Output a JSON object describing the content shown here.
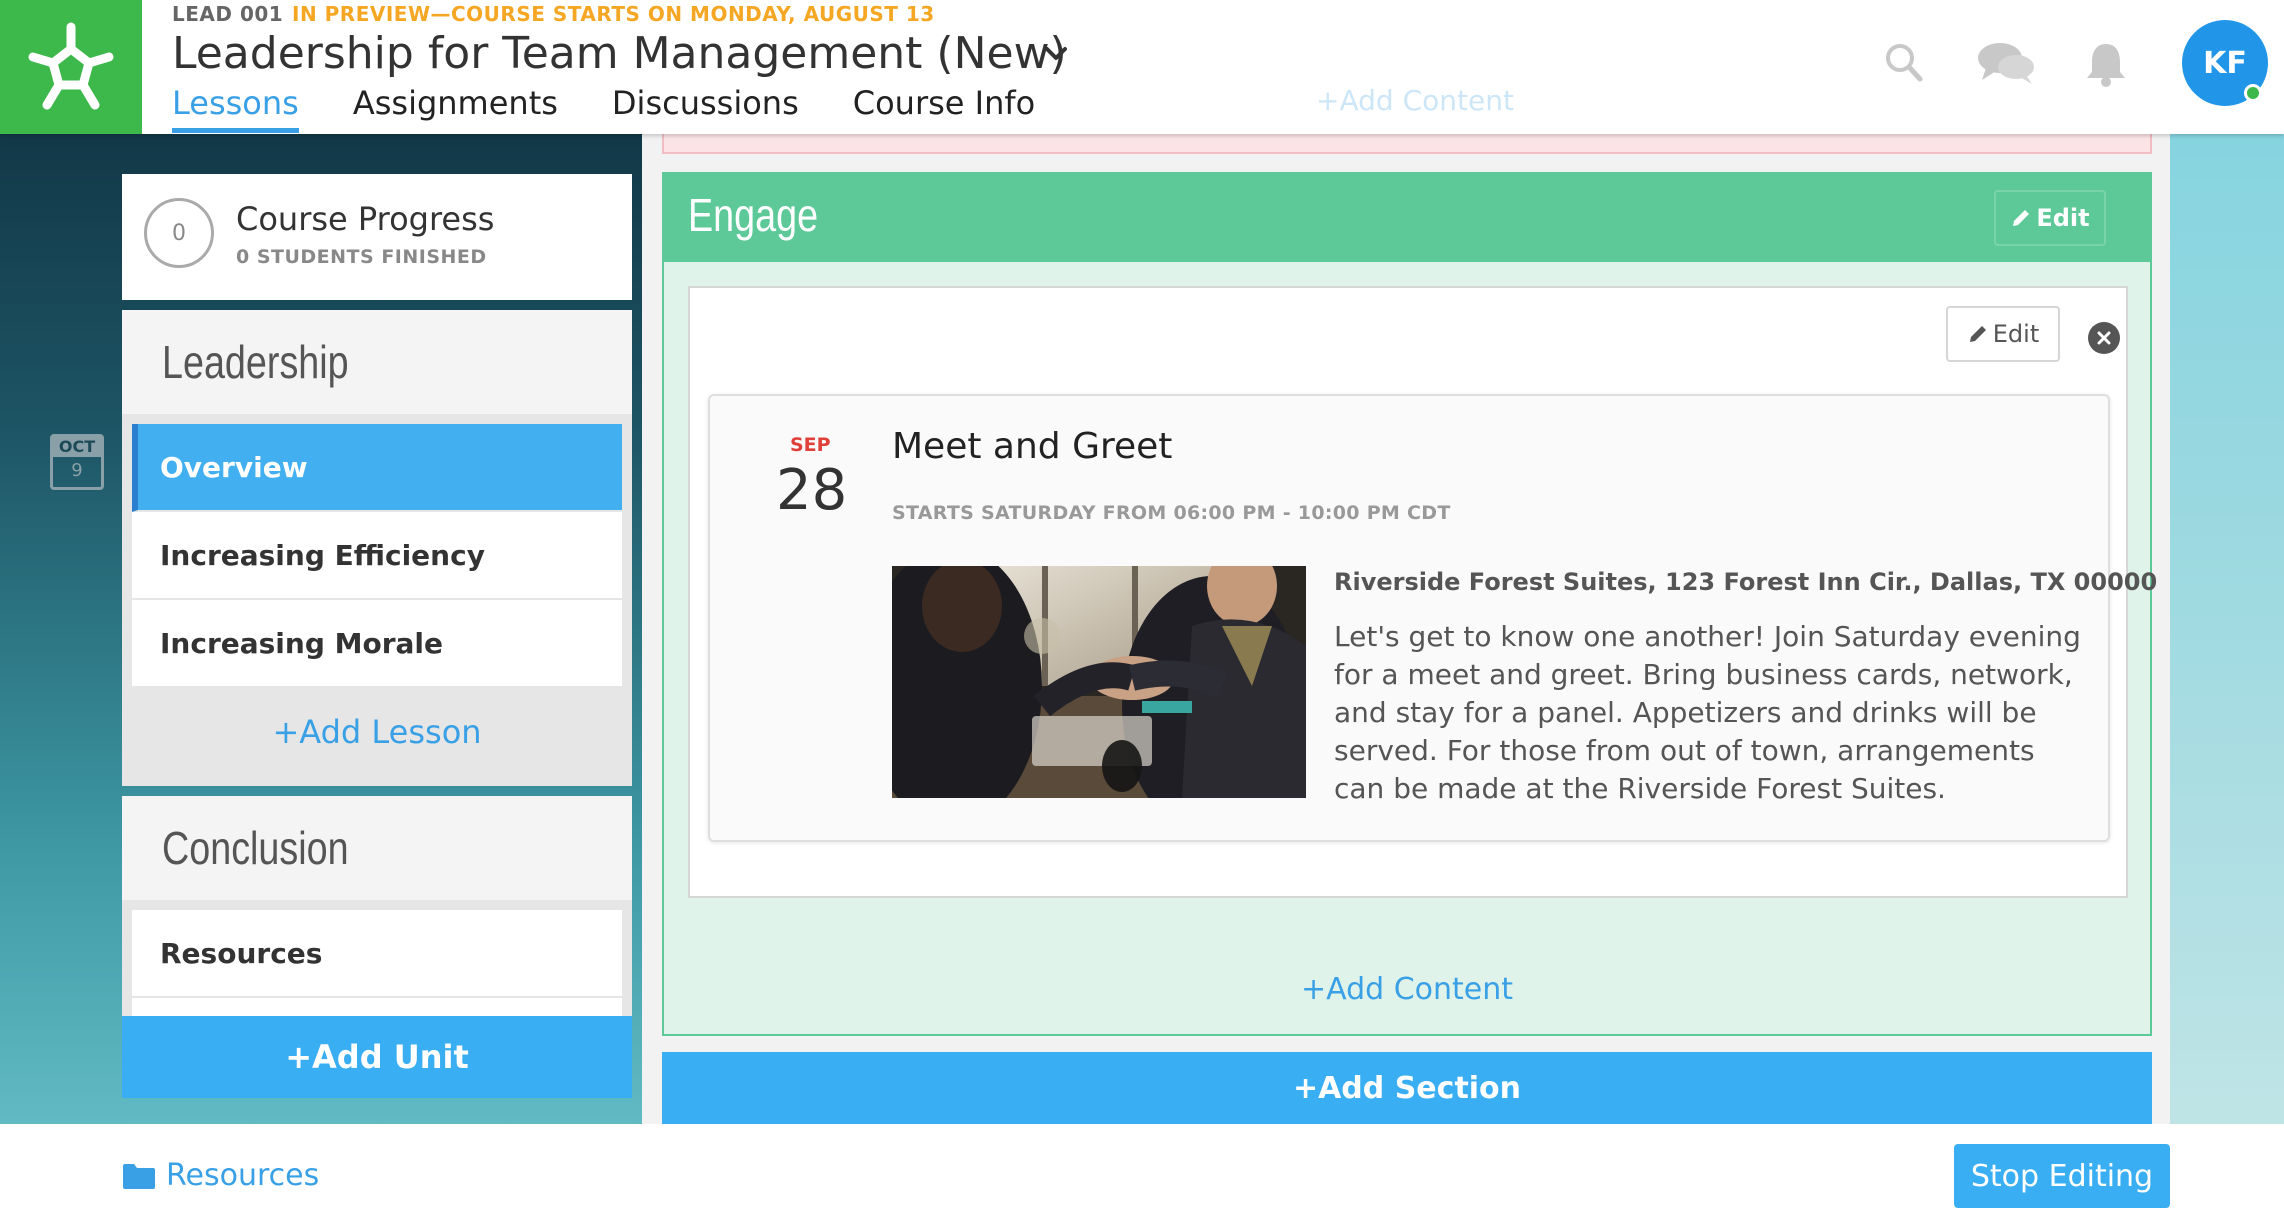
{
  "header": {
    "course_code": "LEAD 001",
    "preview_banner": "IN PREVIEW—COURSE STARTS ON MONDAY, AUGUST 13",
    "course_title": "Leadership for Team Management (New)",
    "tabs": [
      {
        "label": "Lessons",
        "active": true
      },
      {
        "label": "Assignments",
        "active": false
      },
      {
        "label": "Discussions",
        "active": false
      },
      {
        "label": "Course Info",
        "active": false
      }
    ],
    "icons": [
      "search-icon",
      "chat-icon",
      "bell-icon"
    ],
    "avatar_initials": "KF",
    "brand_color": "#3db84a",
    "accent_color": "#3aa0e6"
  },
  "sidebar": {
    "progress": {
      "count": "0",
      "title": "Course Progress",
      "subtitle": "0 STUDENTS FINISHED"
    },
    "date_badge": {
      "month": "OCT",
      "day": "9"
    },
    "units": [
      {
        "title": "Leadership",
        "lessons": [
          {
            "label": "Overview",
            "active": true
          },
          {
            "label": "Increasing Efficiency",
            "active": false
          },
          {
            "label": "Increasing Morale",
            "active": false
          }
        ],
        "add_lesson": "+Add Lesson"
      },
      {
        "title": "Conclusion",
        "lessons": [
          {
            "label": "Resources",
            "active": false
          }
        ]
      }
    ],
    "add_unit": "+Add Unit"
  },
  "main": {
    "faded_add_content": "+Add Content",
    "section": {
      "title": "Engage",
      "edit_label": "Edit",
      "color": "#5dc998",
      "content": {
        "edit_label": "Edit",
        "event": {
          "month": "SEP",
          "day": "28",
          "title": "Meet and Greet",
          "time": "STARTS SATURDAY FROM 06:00 PM - 10:00 PM CDT",
          "location": "Riverside Forest Suites, 123 Forest Inn Cir., Dallas, TX 00000",
          "description": "Let's get to know one another! Join Saturday evening for a meet and greet. Bring business cards, network, and stay for a panel. Appetizers and drinks will be served. For those from out of town, arrangements can be made at the Riverside Forest Suites."
        }
      },
      "add_content": "+Add Content"
    },
    "add_section": "+Add Section"
  },
  "footer": {
    "resources_label": "Resources",
    "stop_editing": "Stop Editing"
  }
}
